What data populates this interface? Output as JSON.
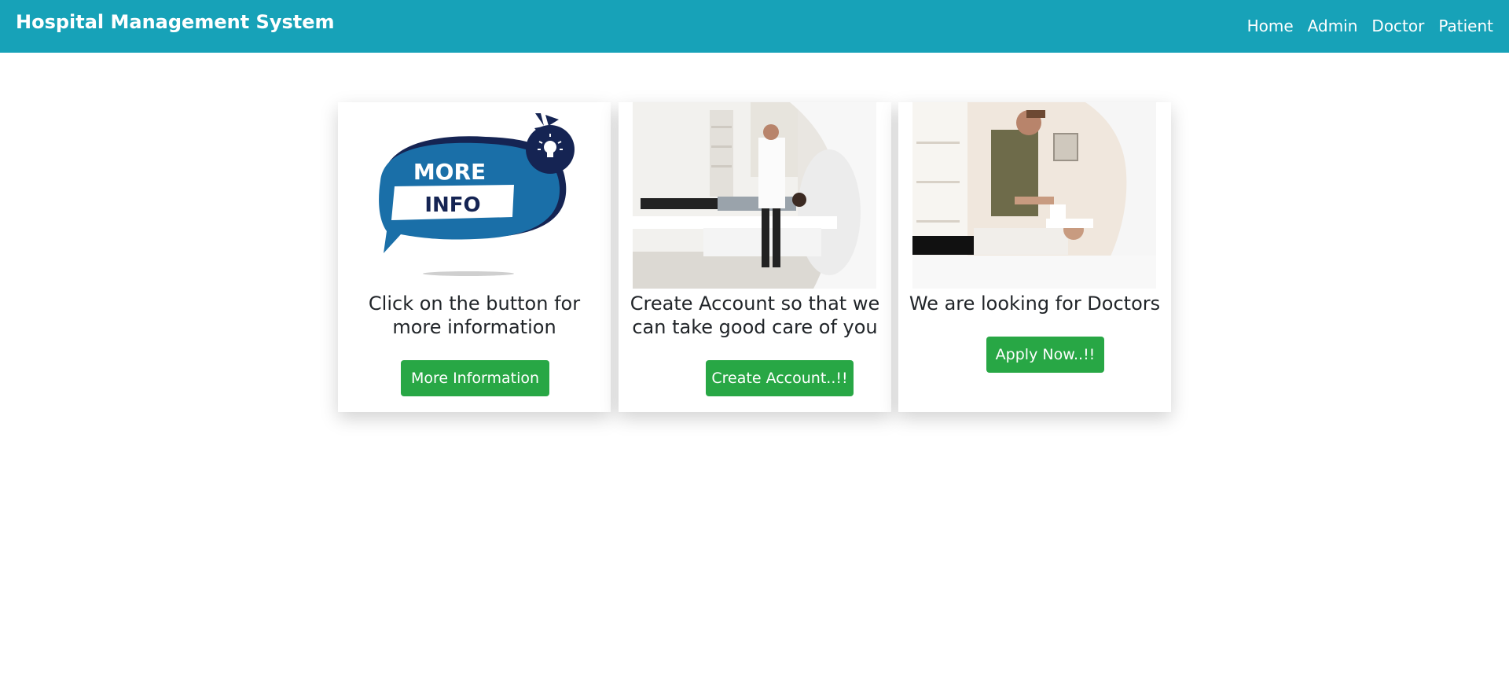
{
  "navbar": {
    "brand": "Hospital Management System",
    "links": [
      "Home",
      "Admin",
      "Doctor",
      "Patient"
    ]
  },
  "cards": [
    {
      "image": "more-info-badge",
      "image_text_top": "MORE",
      "image_text_bottom": "INFO",
      "text": "Click on the button for more information",
      "button": "More Information"
    },
    {
      "image": "mri-scanner-doctor-photo",
      "text": "Create Account so that we can take good care of you",
      "button": "Create Account..!!"
    },
    {
      "image": "mri-technician-patient-photo",
      "text": "We are looking for Doctors",
      "button": "Apply Now..!!"
    }
  ],
  "colors": {
    "navbar": "#17a2b8",
    "button": "#28a745",
    "badge_blue": "#1a6fa8",
    "badge_navy": "#152453"
  }
}
